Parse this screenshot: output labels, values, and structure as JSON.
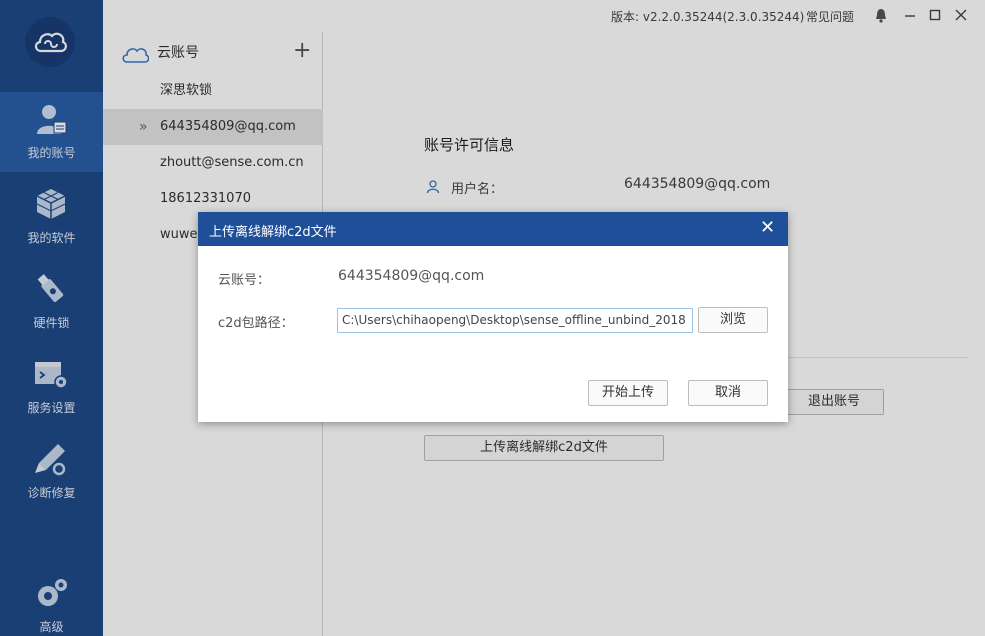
{
  "titlebar": {
    "version": "版本: v2.2.0.35244(2.3.0.35244)",
    "faq": "常见问题"
  },
  "nav": {
    "items": [
      {
        "label": "我的账号",
        "icon": "user-account-icon"
      },
      {
        "label": "我的软件",
        "icon": "software-cubes-icon"
      },
      {
        "label": "硬件锁",
        "icon": "usb-key-icon"
      },
      {
        "label": "服务设置",
        "icon": "service-settings-icon"
      },
      {
        "label": "诊断修复",
        "icon": "diagnose-repair-icon"
      }
    ],
    "advanced": "高级"
  },
  "accounts": {
    "header": "云账号",
    "items": [
      "深思软锁",
      "644354809@qq.com",
      "zhoutt@sense.com.cn",
      "18612331070",
      "wuwe"
    ]
  },
  "detail": {
    "title": "账号许可信息",
    "username_label": "用户名：",
    "username_value": "644354809@qq.com",
    "logout_button": "退出账号",
    "upload_button": "上传离线解绑c2d文件"
  },
  "dialog": {
    "title": "上传离线解绑c2d文件",
    "account_label": "云账号：",
    "account_value": "644354809@qq.com",
    "path_label": "c2d包路径：",
    "path_value": "C:\\Users\\chihaopeng\\Desktop\\sense_offline_unbind_2018",
    "browse_button": "浏览",
    "upload_button": "开始上传",
    "cancel_button": "取消"
  },
  "colors": {
    "nav_bg": "#1f4a8a",
    "nav_active": "#2a5ea8",
    "dialog_header": "#1f4f99"
  }
}
